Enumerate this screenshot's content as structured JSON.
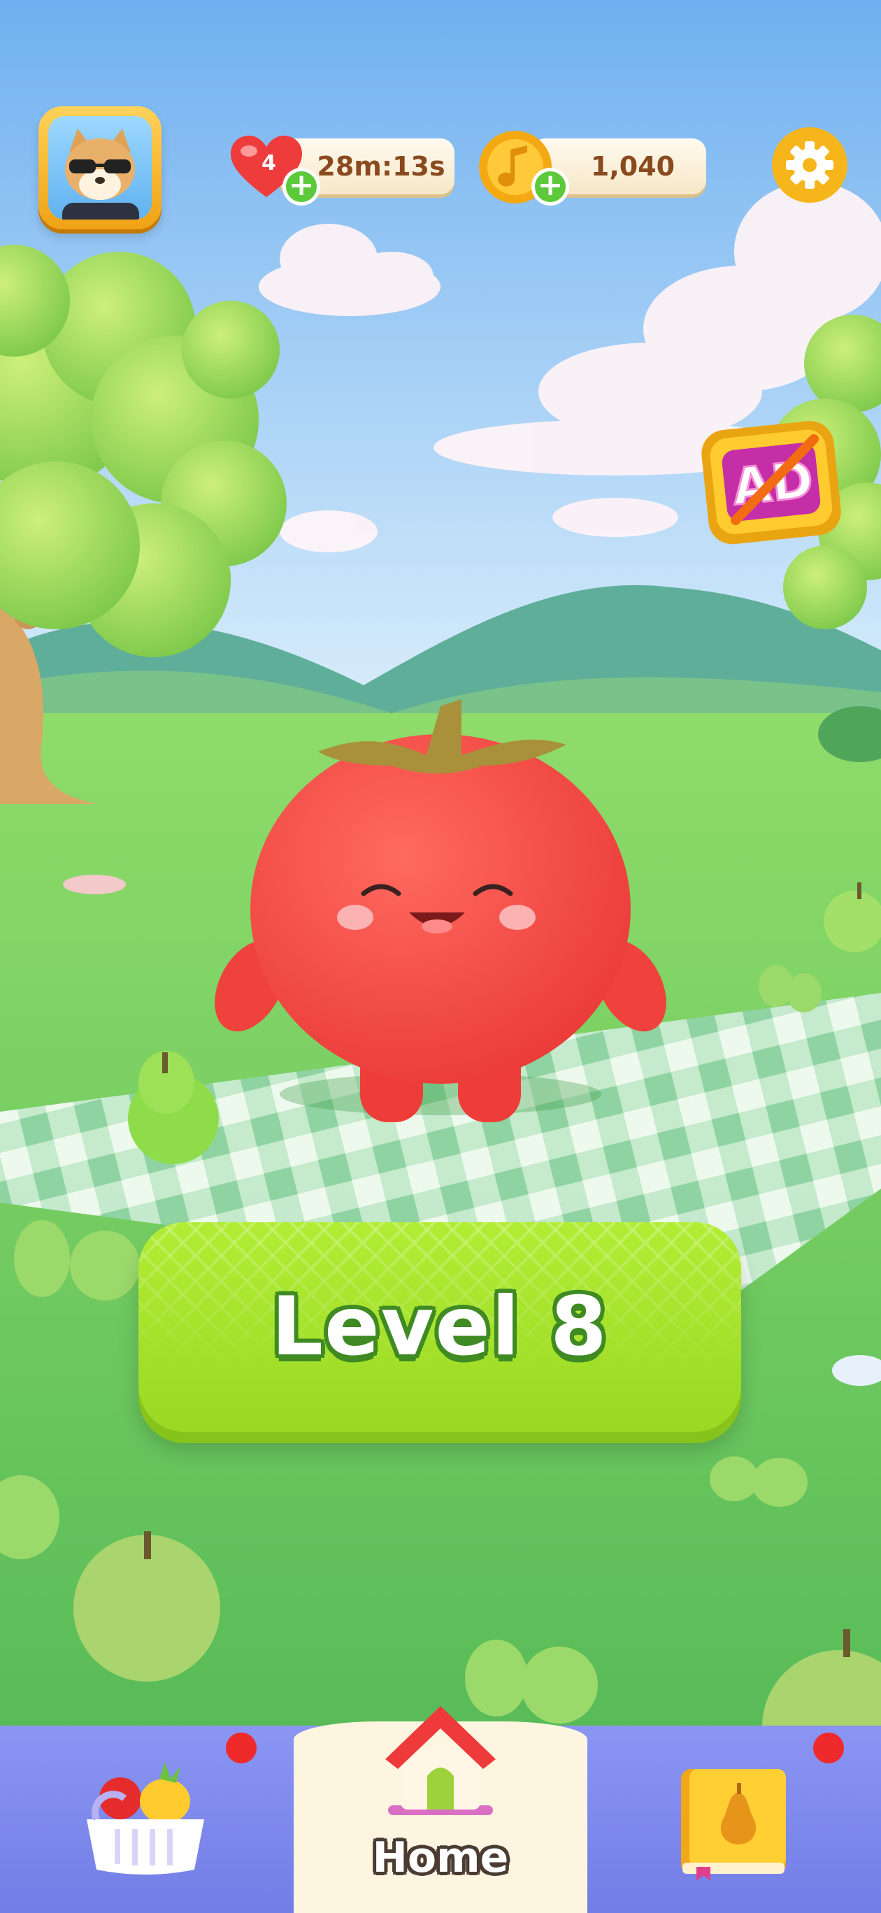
{
  "hud": {
    "avatar_icon": "shiba-dog-sunglasses-avatar",
    "lives": {
      "count": "4",
      "timer": "28m:13s",
      "icon": "heart-icon",
      "add_icon": "plus-icon"
    },
    "coins": {
      "amount": "1,040",
      "icon": "music-note-coin-icon",
      "add_icon": "plus-icon"
    },
    "settings_icon": "gear-icon",
    "remove_ads": {
      "text": "AD",
      "icon": "no-ads-icon"
    }
  },
  "play_button": {
    "label": "Level 8"
  },
  "bottom_nav": {
    "tabs": [
      {
        "id": "shop",
        "icon": "fruit-basket-icon",
        "notification": true
      },
      {
        "id": "home",
        "label": "Home",
        "icon": "house-icon",
        "active": true
      },
      {
        "id": "collection",
        "icon": "pear-book-icon",
        "notification": true
      }
    ]
  },
  "colors": {
    "sky": "#7ab8f2",
    "grass": "#6fcf5b",
    "tomato": "#f24a44",
    "level_button": "#a6e22e",
    "nav_bar": "#7f8aee",
    "nav_active": "#fdf5e0",
    "notification_dot": "#ef2a2a"
  }
}
